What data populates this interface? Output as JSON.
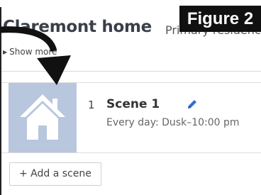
{
  "figure": {
    "label": "Figure 2"
  },
  "home": {
    "title": "Claremont home",
    "subtitle": "Primary residence",
    "show_more_label": "Show more"
  },
  "scenes": [
    {
      "number": "1",
      "name": "Scene 1",
      "schedule": "Every day: Dusk–10:00 pm",
      "thumbnail_icon": "house-icon",
      "thumbnail_color": "#b8c6de"
    }
  ],
  "actions": {
    "add_scene_label": "+ Add a scene"
  },
  "colors": {
    "edit_icon": "#2f6fd6",
    "figure_bg": "#111111",
    "arrow": "#111111"
  }
}
